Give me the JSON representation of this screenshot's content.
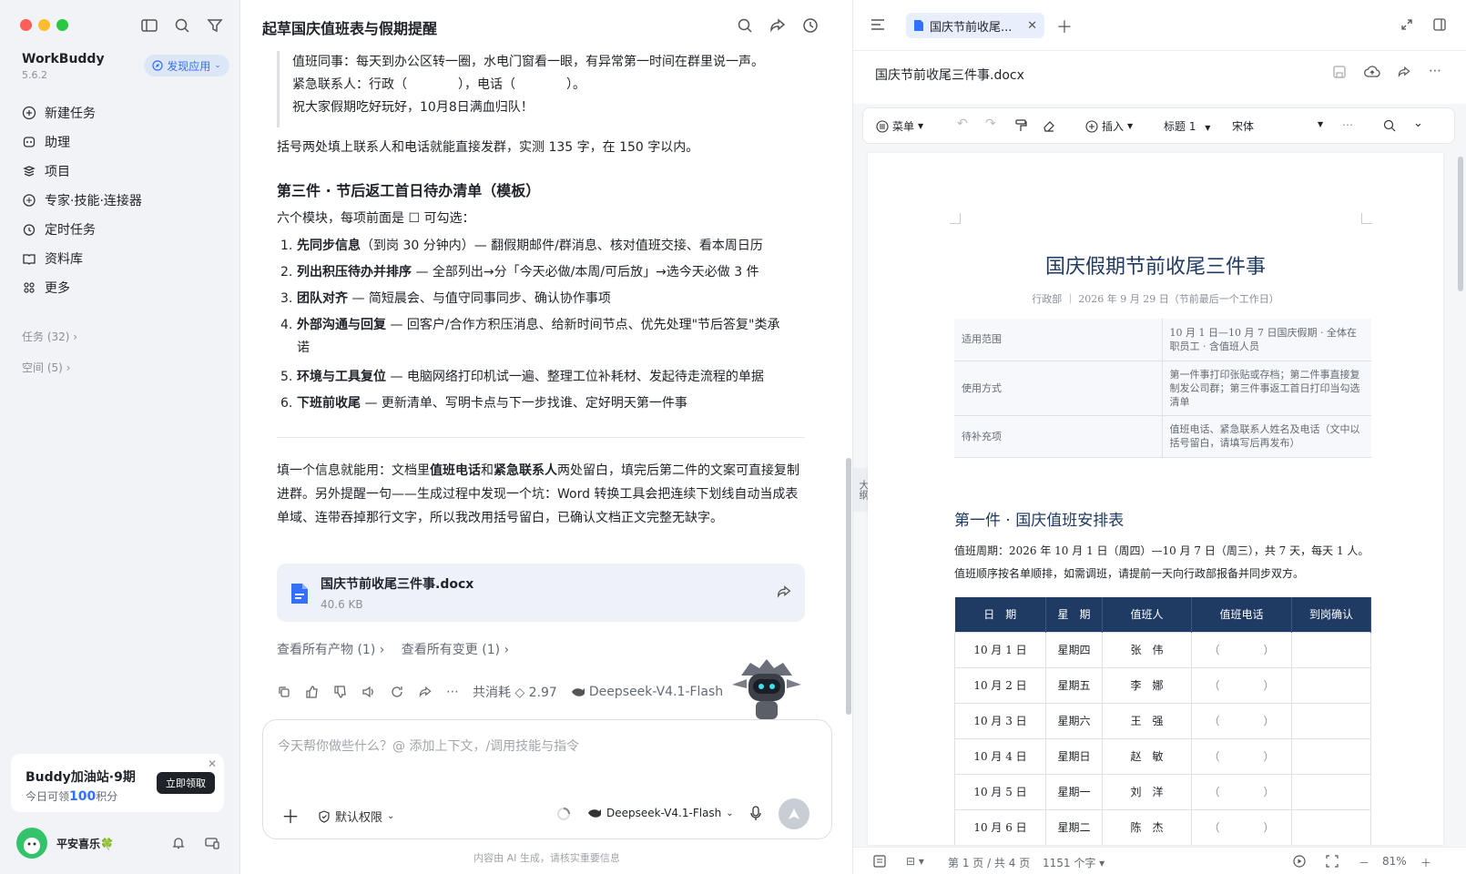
{
  "sidebar": {
    "brand": "WorkBuddy",
    "version": "5.6.2",
    "discover_label": "发现应用",
    "items": [
      {
        "label": "新建任务"
      },
      {
        "label": "助理"
      },
      {
        "label": "项目"
      },
      {
        "label": "专家·技能·连接器"
      },
      {
        "label": "定时任务"
      },
      {
        "label": "资料库"
      },
      {
        "label": "更多"
      }
    ],
    "tasks_label": "任务 (32)",
    "spaces_label": "空间 (5)",
    "promo": {
      "title": "Buddy加油站·9期",
      "sub_prefix": "今日可领",
      "sub_points": "100",
      "sub_suffix": "积分",
      "button": "立即领取"
    },
    "username": "平安喜乐🍀"
  },
  "chat": {
    "title": "起草国庆值班表与假期提醒",
    "quote_lines": [
      "值班同事：每天到办公区转一圈，水电门窗看一眼，有异常第一时间在群里说一声。",
      "紧急联系人：行政（　　　　），电话（　　　　）。",
      "祝大家假期吃好玩好，10月8日满血归队！"
    ],
    "note": "括号两处填上联系人和电话就能直接发群，实测 135 字，在 150 字以内。",
    "heading": "第三件 · 节后返工首日待办清单（模板）",
    "intro": "六个模块，每项前面是 ☐ 可勾选：",
    "list": [
      {
        "num": "1.",
        "bold": "先同步信息",
        "rest": "（到岗 30 分钟内）— 翻假期邮件/群消息、核对值班交接、看本周日历"
      },
      {
        "num": "2.",
        "bold": "列出积压待办并排序",
        "rest": " — 全部列出→分「今天必做/本周/可后放」→选今天必做 3 件"
      },
      {
        "num": "3.",
        "bold": "团队对齐",
        "rest": " — 简短晨会、与值守同事同步、确认协作事项"
      },
      {
        "num": "4.",
        "bold": "外部沟通与回复",
        "rest": " — 回客户/合作方积压消息、给新时间节点、优先处理\"节后答复\"类承诺"
      },
      {
        "num": "5.",
        "bold": "环境与工具复位",
        "rest": " — 电脑网络打印机试一遍、整理工位补耗材、发起待走流程的单据"
      },
      {
        "num": "6.",
        "bold": "下班前收尾",
        "rest": " — 更新清单、写明卡点与下一步找谁、定好明天第一件事"
      }
    ],
    "summary": {
      "p1": "填一个信息就能用：文档里",
      "b1": "值班电话",
      "p2": "和",
      "b2": "紧急联系人",
      "p3": "两处留白，填完后第二件的文案可直接复制进群。另外提醒一句——生成过程中发现一个坑：Word 转换工具会把连续下划线自动当成表单域、连带吞掉那行文字，所以我改用括号留白，已确认文档正文完整无缺字。"
    },
    "file": {
      "name": "国庆节前收尾三件事.docx",
      "size": "40.6 KB"
    },
    "link_artifacts": "查看所有产物 (1)",
    "link_changes": "查看所有变更 (1)",
    "cost": "共消耗 ◇ 2.97",
    "model": "Deepseek-V4.1-Flash",
    "input_placeholder": "今天帮你做些什么？@ 添加上下文，/调用技能与指令",
    "permission": "默认权限",
    "model_select": "Deepseek-V4.1-Flash",
    "footer": "内容由 AI 生成，请核实重要信息"
  },
  "doc": {
    "tab_label": "国庆节前收尾...",
    "file_name": "国庆节前收尾三件事.docx",
    "toolbar": {
      "menu": "菜单",
      "insert": "插入",
      "style": "标题 1",
      "font": "宋体"
    },
    "outline": "大纲",
    "title": "国庆假期节前收尾三件事",
    "subtitle": "行政部 ｜ 2026 年 9 月 29 日（节前最后一个工作日）",
    "info_rows": [
      {
        "key": "适用范围",
        "value": "10 月 1 日—10 月 7 日国庆假期 · 全体在职员工 · 含值班人员"
      },
      {
        "key": "使用方式",
        "value": "第一件事打印张贴或存档；第二件事直接复制发公司群；第三件事返工首日打印当勾选清单"
      },
      {
        "key": "待补充项",
        "value": "值班电话、紧急联系人姓名及电话（文中以括号留白，请填写后再发布）"
      }
    ],
    "section1": "第一件 · 国庆值班安排表",
    "duty_period": "值班周期：2026 年 10 月 1 日（周四）—10 月 7 日（周三），共 7 天，每天 1 人。",
    "duty_order": "值班顺序按名单顺排，如需调班，请提前一天向行政部报备并同步双方。",
    "duty_headers": [
      "日　期",
      "星　期",
      "值班人",
      "值班电话",
      "到岗确认"
    ],
    "duty_rows": [
      [
        "10 月 1 日",
        "星期四",
        "张　伟",
        "（　　　　）",
        ""
      ],
      [
        "10 月 2 日",
        "星期五",
        "李　娜",
        "（　　　　）",
        ""
      ],
      [
        "10 月 3 日",
        "星期六",
        "王　强",
        "（　　　　）",
        ""
      ],
      [
        "10 月 4 日",
        "星期日",
        "赵　敏",
        "（　　　　）",
        ""
      ],
      [
        "10 月 5 日",
        "星期一",
        "刘　洋",
        "（　　　　）",
        ""
      ],
      [
        "10 月 6 日",
        "星期二",
        "陈　杰",
        "（　　　　）",
        ""
      ]
    ],
    "status": {
      "page": "第 1 页 / 共 4 页",
      "words": "1151 个字",
      "zoom": "81%"
    }
  },
  "colors": {
    "accent": "#3370ff",
    "navy": "#1f3a63"
  }
}
